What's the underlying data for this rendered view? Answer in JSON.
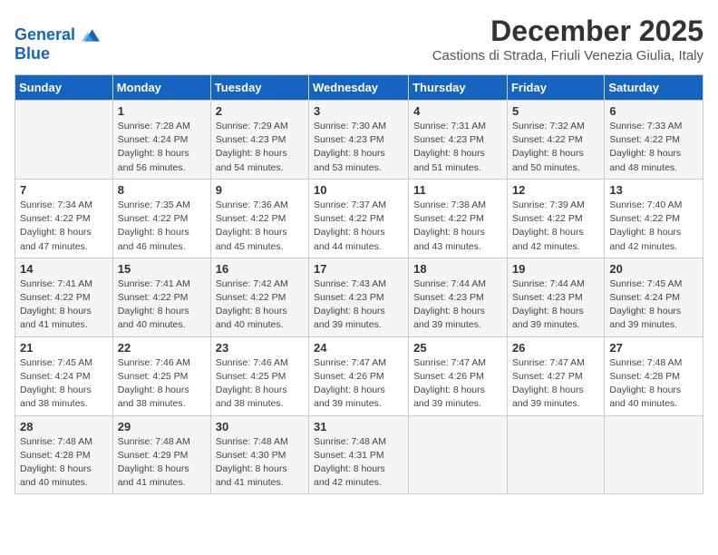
{
  "logo": {
    "line1": "General",
    "line2": "Blue"
  },
  "title": "December 2025",
  "subtitle": "Castions di Strada, Friuli Venezia Giulia, Italy",
  "days_header": [
    "Sunday",
    "Monday",
    "Tuesday",
    "Wednesday",
    "Thursday",
    "Friday",
    "Saturday"
  ],
  "weeks": [
    [
      {
        "day": "",
        "info": ""
      },
      {
        "day": "1",
        "info": "Sunrise: 7:28 AM\nSunset: 4:24 PM\nDaylight: 8 hours\nand 56 minutes."
      },
      {
        "day": "2",
        "info": "Sunrise: 7:29 AM\nSunset: 4:23 PM\nDaylight: 8 hours\nand 54 minutes."
      },
      {
        "day": "3",
        "info": "Sunrise: 7:30 AM\nSunset: 4:23 PM\nDaylight: 8 hours\nand 53 minutes."
      },
      {
        "day": "4",
        "info": "Sunrise: 7:31 AM\nSunset: 4:23 PM\nDaylight: 8 hours\nand 51 minutes."
      },
      {
        "day": "5",
        "info": "Sunrise: 7:32 AM\nSunset: 4:22 PM\nDaylight: 8 hours\nand 50 minutes."
      },
      {
        "day": "6",
        "info": "Sunrise: 7:33 AM\nSunset: 4:22 PM\nDaylight: 8 hours\nand 48 minutes."
      }
    ],
    [
      {
        "day": "7",
        "info": "Sunrise: 7:34 AM\nSunset: 4:22 PM\nDaylight: 8 hours\nand 47 minutes."
      },
      {
        "day": "8",
        "info": "Sunrise: 7:35 AM\nSunset: 4:22 PM\nDaylight: 8 hours\nand 46 minutes."
      },
      {
        "day": "9",
        "info": "Sunrise: 7:36 AM\nSunset: 4:22 PM\nDaylight: 8 hours\nand 45 minutes."
      },
      {
        "day": "10",
        "info": "Sunrise: 7:37 AM\nSunset: 4:22 PM\nDaylight: 8 hours\nand 44 minutes."
      },
      {
        "day": "11",
        "info": "Sunrise: 7:38 AM\nSunset: 4:22 PM\nDaylight: 8 hours\nand 43 minutes."
      },
      {
        "day": "12",
        "info": "Sunrise: 7:39 AM\nSunset: 4:22 PM\nDaylight: 8 hours\nand 42 minutes."
      },
      {
        "day": "13",
        "info": "Sunrise: 7:40 AM\nSunset: 4:22 PM\nDaylight: 8 hours\nand 42 minutes."
      }
    ],
    [
      {
        "day": "14",
        "info": "Sunrise: 7:41 AM\nSunset: 4:22 PM\nDaylight: 8 hours\nand 41 minutes."
      },
      {
        "day": "15",
        "info": "Sunrise: 7:41 AM\nSunset: 4:22 PM\nDaylight: 8 hours\nand 40 minutes."
      },
      {
        "day": "16",
        "info": "Sunrise: 7:42 AM\nSunset: 4:22 PM\nDaylight: 8 hours\nand 40 minutes."
      },
      {
        "day": "17",
        "info": "Sunrise: 7:43 AM\nSunset: 4:23 PM\nDaylight: 8 hours\nand 39 minutes."
      },
      {
        "day": "18",
        "info": "Sunrise: 7:44 AM\nSunset: 4:23 PM\nDaylight: 8 hours\nand 39 minutes."
      },
      {
        "day": "19",
        "info": "Sunrise: 7:44 AM\nSunset: 4:23 PM\nDaylight: 8 hours\nand 39 minutes."
      },
      {
        "day": "20",
        "info": "Sunrise: 7:45 AM\nSunset: 4:24 PM\nDaylight: 8 hours\nand 39 minutes."
      }
    ],
    [
      {
        "day": "21",
        "info": "Sunrise: 7:45 AM\nSunset: 4:24 PM\nDaylight: 8 hours\nand 38 minutes."
      },
      {
        "day": "22",
        "info": "Sunrise: 7:46 AM\nSunset: 4:25 PM\nDaylight: 8 hours\nand 38 minutes."
      },
      {
        "day": "23",
        "info": "Sunrise: 7:46 AM\nSunset: 4:25 PM\nDaylight: 8 hours\nand 38 minutes."
      },
      {
        "day": "24",
        "info": "Sunrise: 7:47 AM\nSunset: 4:26 PM\nDaylight: 8 hours\nand 39 minutes."
      },
      {
        "day": "25",
        "info": "Sunrise: 7:47 AM\nSunset: 4:26 PM\nDaylight: 8 hours\nand 39 minutes."
      },
      {
        "day": "26",
        "info": "Sunrise: 7:47 AM\nSunset: 4:27 PM\nDaylight: 8 hours\nand 39 minutes."
      },
      {
        "day": "27",
        "info": "Sunrise: 7:48 AM\nSunset: 4:28 PM\nDaylight: 8 hours\nand 40 minutes."
      }
    ],
    [
      {
        "day": "28",
        "info": "Sunrise: 7:48 AM\nSunset: 4:28 PM\nDaylight: 8 hours\nand 40 minutes."
      },
      {
        "day": "29",
        "info": "Sunrise: 7:48 AM\nSunset: 4:29 PM\nDaylight: 8 hours\nand 41 minutes."
      },
      {
        "day": "30",
        "info": "Sunrise: 7:48 AM\nSunset: 4:30 PM\nDaylight: 8 hours\nand 41 minutes."
      },
      {
        "day": "31",
        "info": "Sunrise: 7:48 AM\nSunset: 4:31 PM\nDaylight: 8 hours\nand 42 minutes."
      },
      {
        "day": "",
        "info": ""
      },
      {
        "day": "",
        "info": ""
      },
      {
        "day": "",
        "info": ""
      }
    ]
  ]
}
